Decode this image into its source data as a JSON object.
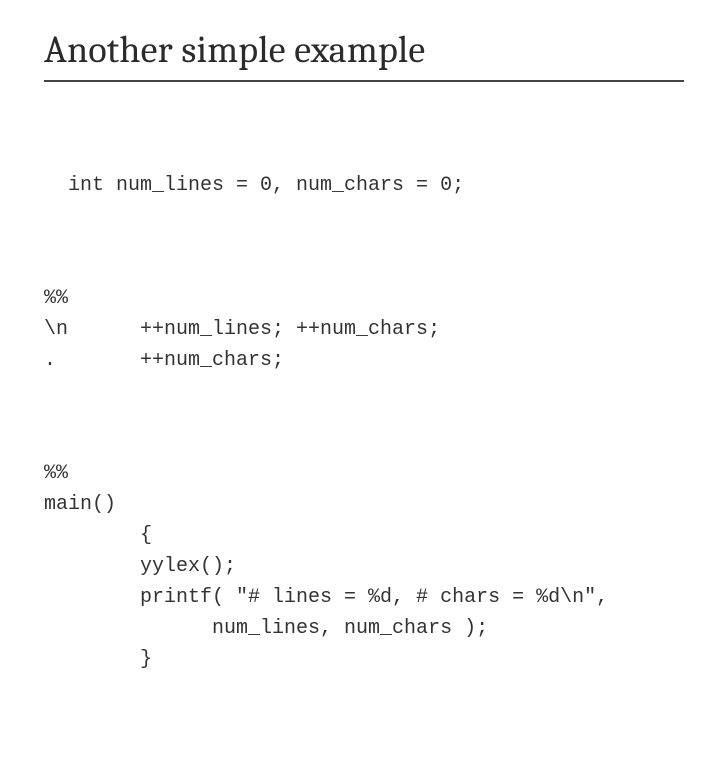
{
  "title": "Another simple example",
  "code": {
    "l1": "  int num_lines = 0, num_chars = 0;",
    "l2": "%%",
    "l3": "\\n      ++num_lines; ++num_chars;",
    "l4": ".       ++num_chars;",
    "l5": "%%",
    "l6": "main()",
    "l7": "        {",
    "l8": "        yylex();",
    "l9": "        printf( \"# lines = %d, # chars = %d\\n\",",
    "l10": "              num_lines, num_chars );",
    "l11": "        }"
  }
}
